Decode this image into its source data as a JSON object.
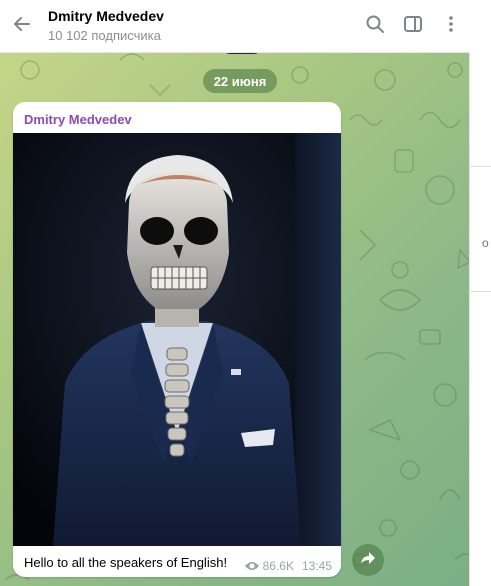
{
  "header": {
    "title": "Dmitry Medvedev",
    "subtitle": "10 102 подписчика",
    "back_icon": "arrow-left-icon",
    "actions": [
      "search-icon",
      "sidebar-toggle-icon",
      "more-vertical-icon"
    ]
  },
  "chat": {
    "date_separator": "22 июня",
    "right_panel_fragment": "o"
  },
  "message": {
    "author": "Dmitry Medvedev",
    "photo_icon": "photo-image",
    "caption": "Hello to all the speakers of English!",
    "views": "86.6K",
    "time": "13:45",
    "share_icon": "share-arrow-icon"
  },
  "colors": {
    "author": "#8a4bb3",
    "pill_bg": "#497440",
    "wallpaper_start": "#c9d78a",
    "wallpaper_end": "#7aae85"
  }
}
